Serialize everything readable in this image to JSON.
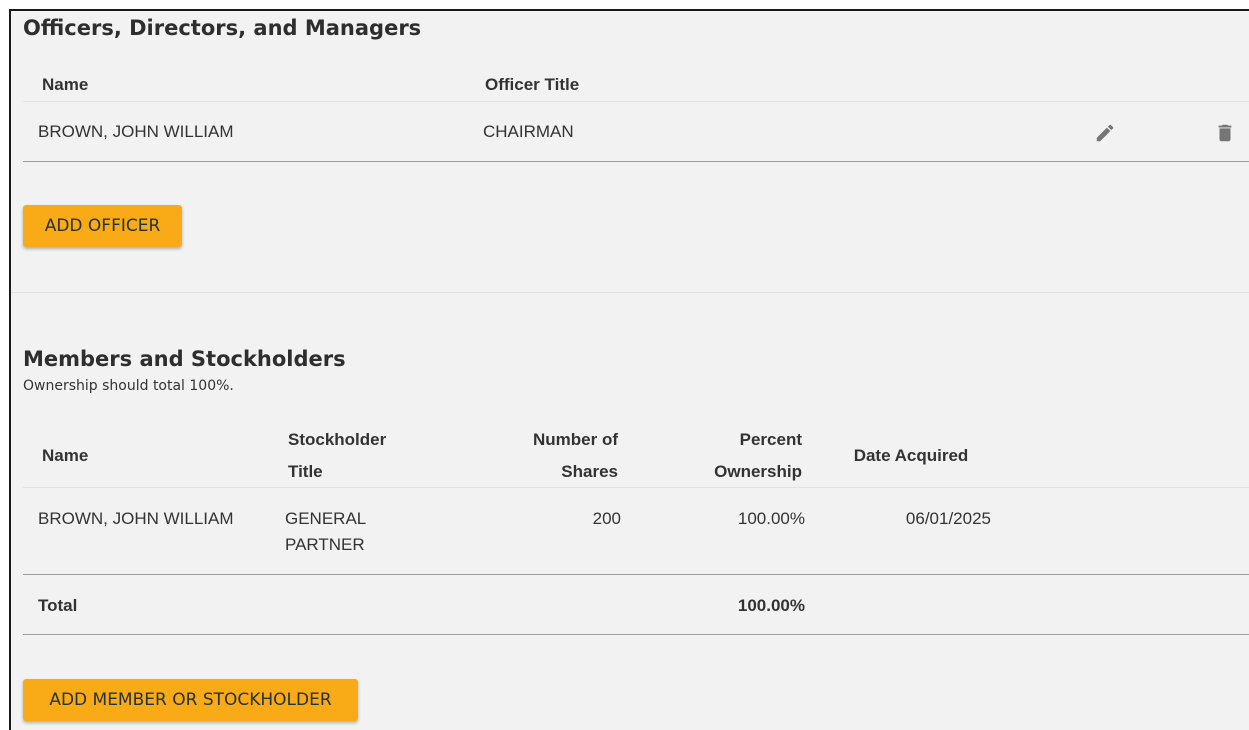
{
  "officers": {
    "title": "Officers, Directors, and Managers",
    "columns": {
      "name": "Name",
      "title": "Officer Title"
    },
    "rows": [
      {
        "name": "BROWN, JOHN WILLIAM",
        "title": "CHAIRMAN"
      }
    ],
    "add_button": "ADD OFFICER",
    "icons": {
      "edit": "pencil-icon",
      "delete": "trash-icon"
    }
  },
  "members": {
    "title": "Members and Stockholders",
    "subtitle": "Ownership should total 100%.",
    "columns": {
      "name": "Name",
      "title_1": "Stockholder",
      "title_2": "Title",
      "shares_1": "Number of",
      "shares_2": "Shares",
      "percent_1": "Percent",
      "percent_2": "Ownership",
      "date": "Date Acquired"
    },
    "rows": [
      {
        "name": "BROWN, JOHN WILLIAM",
        "title_1": "GENERAL",
        "title_2": "PARTNER",
        "shares": "200",
        "percent": "100.00%",
        "date": "06/01/2025"
      }
    ],
    "total": {
      "label": "Total",
      "percent": "100.00%"
    },
    "add_button": "ADD MEMBER OR STOCKHOLDER"
  },
  "colors": {
    "button": "#f9ab17",
    "background": "#f2f2f2"
  }
}
